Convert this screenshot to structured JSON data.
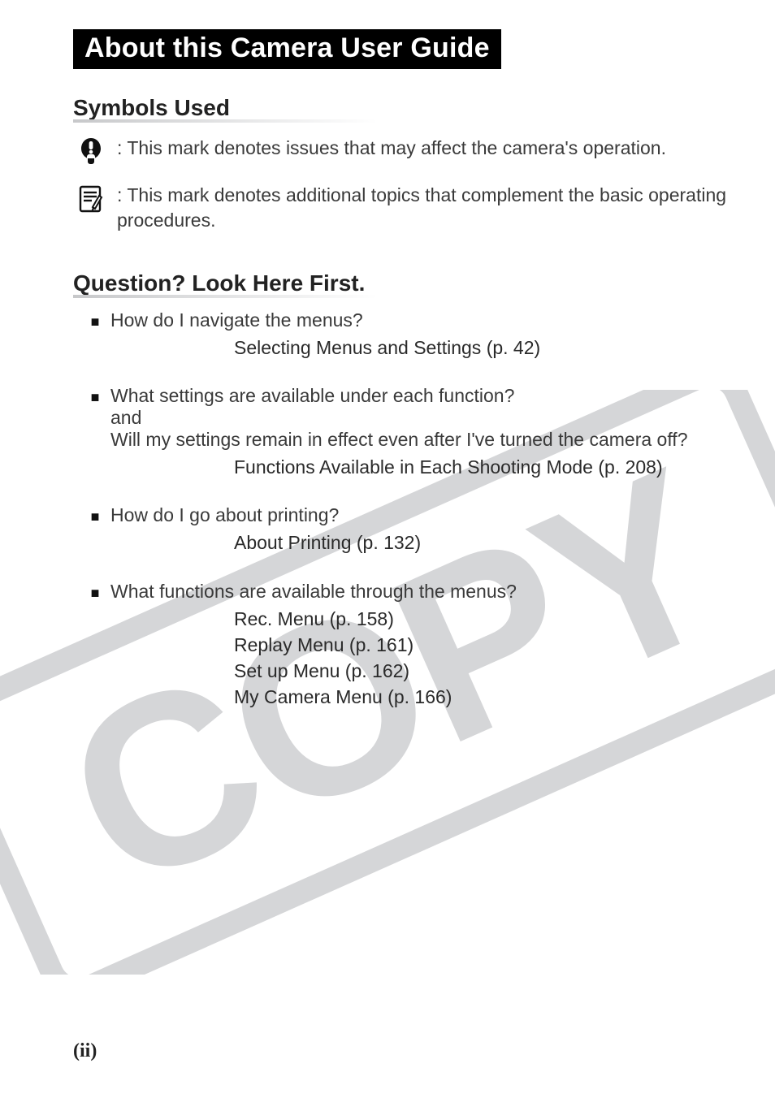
{
  "title": "About this Camera User Guide",
  "sections": {
    "symbols": {
      "heading": "Symbols Used",
      "items": [
        {
          "id": "issue-mark",
          "icon": "exclaim",
          "text": ": This mark denotes issues that may affect the camera's operation."
        },
        {
          "id": "note-mark",
          "icon": "note",
          "text": ": This mark denotes additional topics that complement the basic operating procedures."
        }
      ]
    },
    "questions": {
      "heading": "Question? Look Here First.",
      "items": [
        {
          "question": "How do I navigate the menus?",
          "sublines": [],
          "answers": [
            "Selecting Menus and Settings (p. 42)"
          ]
        },
        {
          "question": "What settings are available under each function?",
          "sublines": [
            "and",
            "Will my settings remain in effect even after I've turned the camera off?"
          ],
          "answers": [
            "Functions Available in Each Shooting Mode (p. 208)"
          ]
        },
        {
          "question": "How do I go about printing?",
          "sublines": [],
          "answers": [
            "About Printing (p. 132)"
          ]
        },
        {
          "question": "What functions are available through the menus?",
          "sublines": [],
          "answers": [
            "Rec. Menu (p. 158)",
            "Replay Menu (p. 161)",
            "Set up Menu (p. 162)",
            "My Camera Menu (p. 166)"
          ]
        }
      ]
    }
  },
  "page_number": "(ii)"
}
